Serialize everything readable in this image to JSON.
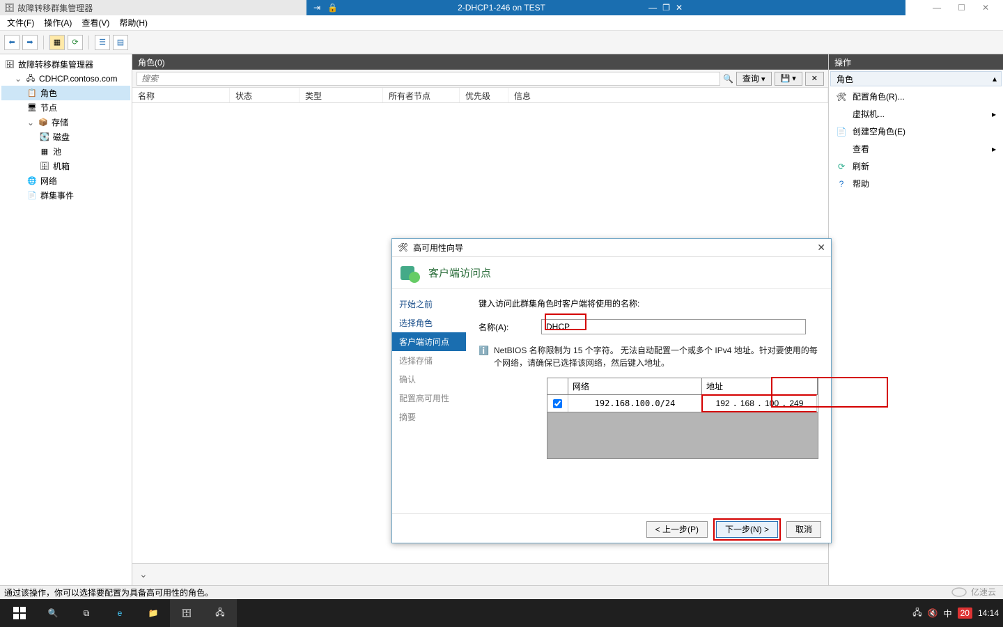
{
  "vm": {
    "app_title_gray": "故障转移群集管理器",
    "title": "2-DHCP1-246 on TEST"
  },
  "menubar": [
    "文件(F)",
    "操作(A)",
    "查看(V)",
    "帮助(H)"
  ],
  "tree": {
    "root": "故障转移群集管理器",
    "cluster": "CDHCP.contoso.com",
    "roles": "角色",
    "nodes": "节点",
    "storage": "存储",
    "disks": "磁盘",
    "pools": "池",
    "enclosures": "机箱",
    "networks": "网络",
    "events": "群集事件"
  },
  "center": {
    "header": "角色(0)",
    "search_placeholder": "搜索",
    "query_btn": "查询",
    "columns": [
      "名称",
      "状态",
      "类型",
      "所有者节点",
      "优先级",
      "信息"
    ]
  },
  "actions": {
    "title": "操作",
    "subtitle": "角色",
    "items": [
      {
        "icon": "cfg",
        "label": "配置角色(R)..."
      },
      {
        "icon": "vm",
        "label": "虚拟机...",
        "arrow": true
      },
      {
        "icon": "empty",
        "label": "创建空角色(E)"
      },
      {
        "icon": "view",
        "label": "查看",
        "arrow": true
      },
      {
        "icon": "refresh",
        "label": "刷新"
      },
      {
        "icon": "help",
        "label": "帮助"
      }
    ]
  },
  "wizard": {
    "title": "高可用性向导",
    "heading": "客户端访问点",
    "steps": [
      "开始之前",
      "选择角色",
      "客户端访问点",
      "选择存储",
      "确认",
      "配置高可用性",
      "摘要"
    ],
    "current_step_index": 2,
    "intro": "键入访问此群集角色时客户端将使用的名称:",
    "name_label": "名称(A):",
    "name_value": "DHCP",
    "info_text": "NetBIOS 名称限制为 15 个字符。 无法自动配置一个或多个 IPv4 地址。针对要使用的每个网络，请确保已选择该网络，然后键入地址。",
    "net_headers": [
      "",
      "网络",
      "地址"
    ],
    "net_row": {
      "checked": true,
      "network": "192.168.100.0/24",
      "addr": [
        "192",
        "168",
        "100",
        "249"
      ]
    },
    "buttons": {
      "prev": "< 上一步(P)",
      "next": "下一步(N) >",
      "cancel": "取消"
    }
  },
  "statusbar": "通过该操作，你可以选择要配置为具备高可用性的角色。",
  "tray": {
    "time": "14:14",
    "date_badge": "20",
    "ime": "中"
  },
  "watermark": "亿速云"
}
